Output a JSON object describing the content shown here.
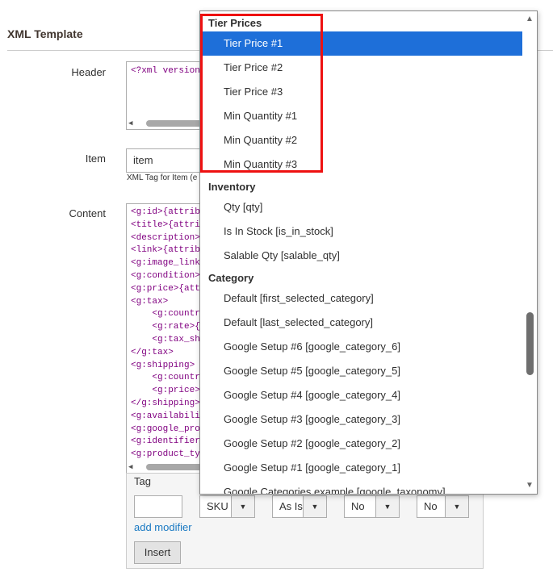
{
  "section": {
    "title": "XML Template"
  },
  "fields": {
    "header_label": "Header",
    "header_value": "<?xml version=",
    "item_label": "Item",
    "item_value": "item",
    "item_hint": "XML Tag for Item (e",
    "content_label": "Content",
    "content_lines": [
      "<g:id>{attribu",
      "<title>{attrib",
      "<description>{",
      "<link>{attribu",
      "<g:image_link>",
      "<g:condition>n",
      "<g:price>{attr",
      "<g:tax>",
      "    <g:country",
      "    <g:rate>{a",
      "    <g:tax_shi",
      "</g:tax>",
      "<g:shipping>",
      "    <g:country",
      "    <g:price>{",
      "</g:shipping>",
      "<g:availabilit",
      "<g:google_prod",
      "<g:identifier_",
      "<g:product_typ"
    ]
  },
  "modifiers": {
    "tag_label": "Tag",
    "attribute_select": "SKU",
    "format_select": "As Is",
    "select_3": "No",
    "select_4": "No",
    "add_modifier": "add modifier",
    "insert_button": "Insert"
  },
  "dropdown": {
    "groups": [
      {
        "label": "Tier Prices",
        "options": [
          "Tier Price #1",
          "Tier Price #2",
          "Tier Price #3",
          "Min Quantity #1",
          "Min Quantity #2",
          "Min Quantity #3"
        ]
      },
      {
        "label": "Inventory",
        "options": [
          "Qty [qty]",
          "Is In Stock [is_in_stock]",
          "Salable Qty [salable_qty]"
        ]
      },
      {
        "label": "Category",
        "options": [
          "Default [first_selected_category]",
          "Default [last_selected_category]",
          "Google Setup #6 [google_category_6]",
          "Google Setup #5 [google_category_5]",
          "Google Setup #4 [google_category_4]",
          "Google Setup #3 [google_category_3]",
          "Google Setup #2 [google_category_2]",
          "Google Setup #1 [google_category_1]",
          "Google Categories example [google_taxonomy]"
        ]
      }
    ],
    "selected": "Tier Price #1"
  },
  "colors": {
    "selection": "#1e6fd9",
    "highlight_box": "#ee1111",
    "link": "#1979c3"
  }
}
